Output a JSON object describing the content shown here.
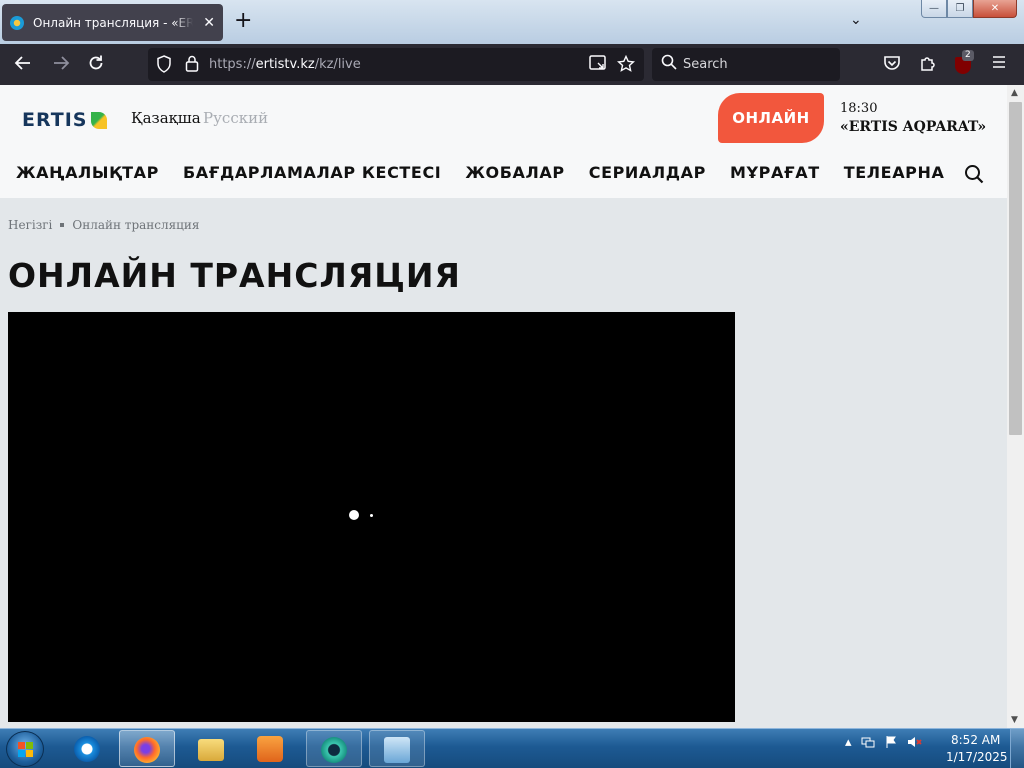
{
  "browser": {
    "tab_title": "Онлайн трансляция - «ERTIS»",
    "tab_close": "✕",
    "new_tab": "+",
    "tab_list": "⌄",
    "url_prefix": "https://",
    "url_host": "ertistv.kz",
    "url_path": "/kz/live",
    "search_placeholder": "Search",
    "extension_badge": "2",
    "window_controls": {
      "minimize": "—",
      "maximize": "❐",
      "close": "✕"
    }
  },
  "site": {
    "logo_text": "ERTIS",
    "languages": {
      "active": "Қазақша",
      "inactive": "Русский"
    },
    "live_button": "ОНЛАЙН",
    "now_playing": {
      "time": "18:30",
      "title": "«ERTIS AQPARAT»"
    },
    "nav": [
      "ЖАҢАЛЫҚТАР",
      "БАҒДАРЛАМАЛАР КЕСТЕСІ",
      "ЖОБАЛАР",
      "СЕРИАЛДАР",
      "МҰРАҒАТ",
      "ТЕЛЕАРНА"
    ],
    "breadcrumb": {
      "home": "Негізгі",
      "current": "Онлайн трансляция"
    },
    "page_title": "ОНЛАЙН ТРАНСЛЯЦИЯ"
  },
  "taskbar": {
    "time": "8:52 AM",
    "date": "1/17/2025"
  },
  "colors": {
    "accent_live": "#f2573d",
    "logo_blue": "#16365c",
    "logo_green": "#35b34a",
    "logo_yellow": "#f7c325"
  }
}
